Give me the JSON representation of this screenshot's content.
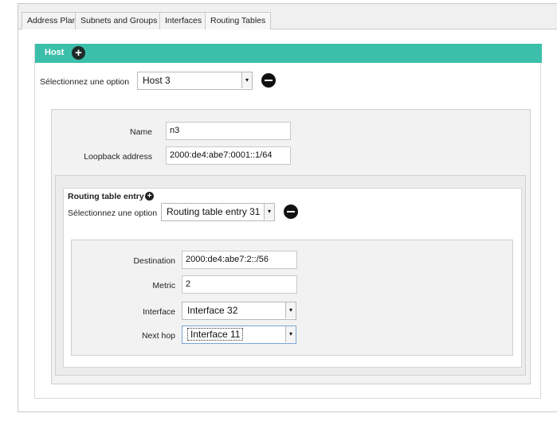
{
  "tabs": [
    {
      "label": "Address Plan"
    },
    {
      "label": "Subnets and Groups"
    },
    {
      "label": "Interfaces"
    },
    {
      "label": "Routing Tables"
    }
  ],
  "host": {
    "title": "Host",
    "select_label": "Sélectionnez une option",
    "selected": "Host 3",
    "name_label": "Name",
    "name_value": "n3",
    "loopback_label": "Loopback address",
    "loopback_value": "2000:de4:abe7:0001::1/64"
  },
  "routing": {
    "title": "Routing table entry",
    "select_label": "Sélectionnez une option",
    "selected": "Routing table entry 31",
    "destination_label": "Destination",
    "destination_value": "2000:de4:abe7:2::/56",
    "metric_label": "Metric",
    "metric_value": "2",
    "interface_label": "Interface",
    "interface_value": "Interface 32",
    "nexthop_label": "Next hop",
    "nexthop_value": "Interface 11"
  },
  "colors": {
    "host_header": "#3cbfaa"
  }
}
